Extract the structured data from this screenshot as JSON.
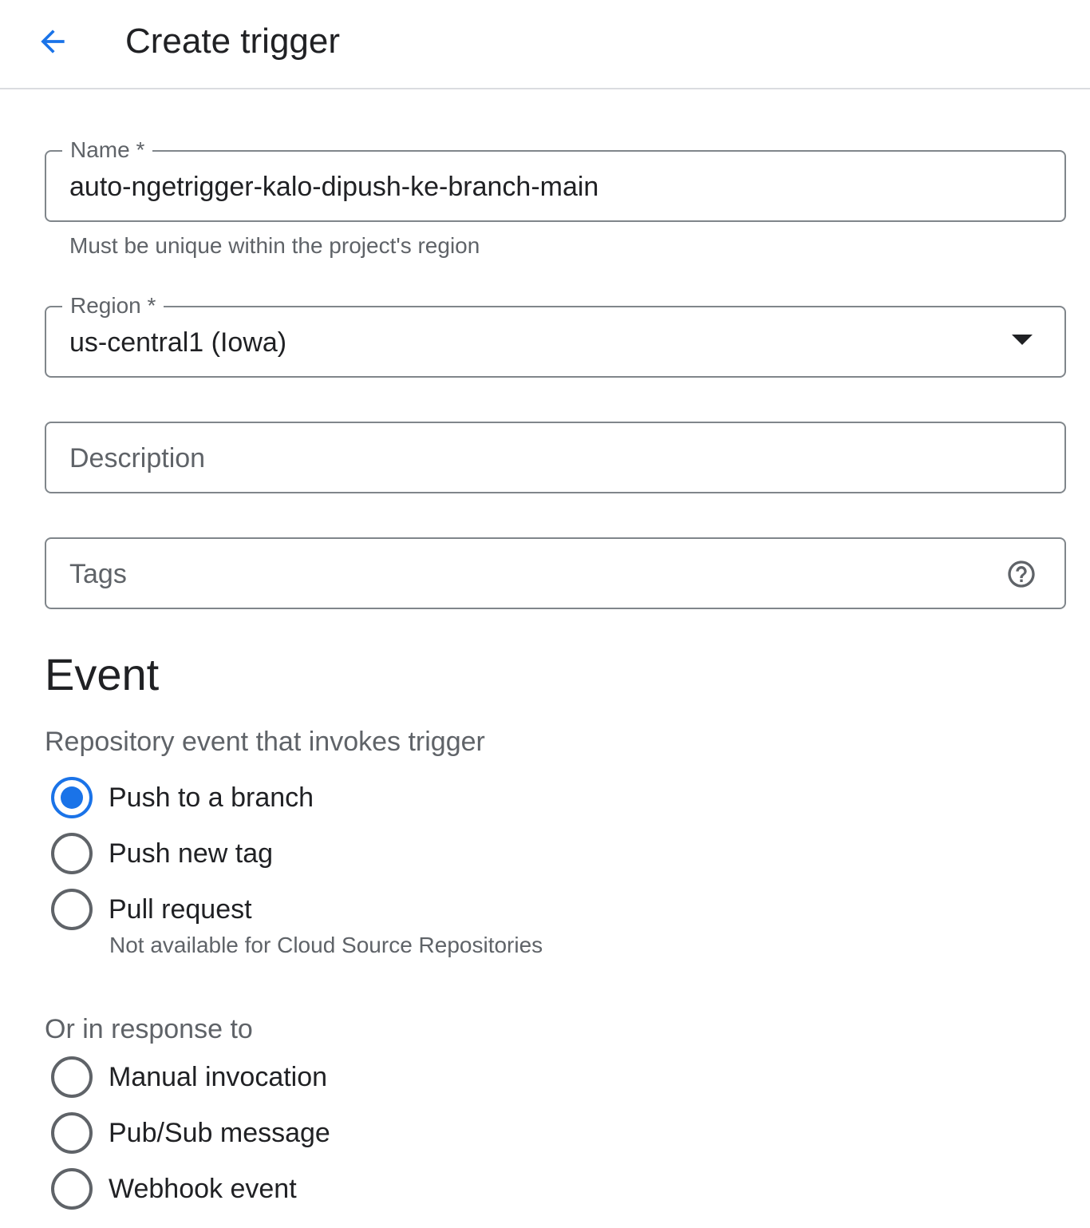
{
  "header": {
    "title": "Create trigger",
    "back_icon": "arrow-back-icon"
  },
  "form": {
    "name": {
      "label": "Name *",
      "value": "auto-ngetrigger-kalo-dipush-ke-branch-main",
      "hint": "Must be unique within the project's region"
    },
    "region": {
      "label": "Region *",
      "value": "us-central1 (Iowa)"
    },
    "description": {
      "placeholder": "Description"
    },
    "tags": {
      "placeholder": "Tags",
      "help_icon": "help-circle-icon"
    }
  },
  "event": {
    "title": "Event",
    "repo_heading": "Repository event that invokes trigger",
    "repo_options": [
      {
        "label": "Push to a branch",
        "checked": true
      },
      {
        "label": "Push new tag",
        "checked": false
      },
      {
        "label": "Pull request",
        "checked": false,
        "hint": "Not available for Cloud Source Repositories"
      }
    ],
    "other_heading": "Or in response to",
    "other_options": [
      {
        "label": "Manual invocation",
        "checked": false
      },
      {
        "label": "Pub/Sub message",
        "checked": false
      },
      {
        "label": "Webhook event",
        "checked": false
      }
    ]
  },
  "colors": {
    "accent": "#1a73e8",
    "border": "#80868b",
    "text": "#202124",
    "secondary_text": "#5f6368"
  }
}
